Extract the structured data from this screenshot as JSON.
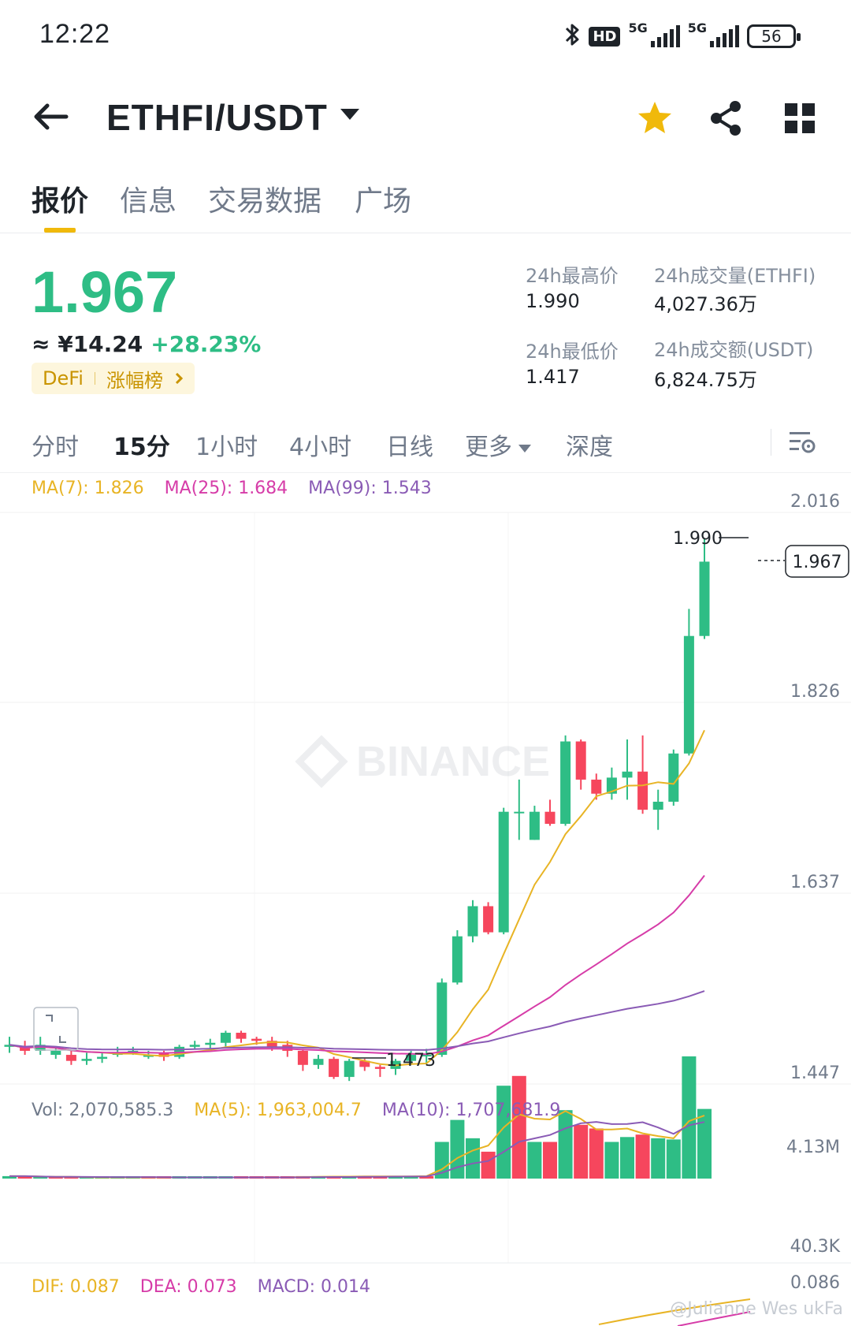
{
  "status_bar": {
    "time": "12:22",
    "hd_label": "HD",
    "sim1_label": "5G",
    "sim2_label": "5G",
    "battery": "56",
    "icons": [
      "bluetooth-icon",
      "hd-voice-icon",
      "signal-icon",
      "signal-icon",
      "battery-icon"
    ]
  },
  "header": {
    "pair": "ETHFI/USDT",
    "icons": [
      "back-arrow-icon",
      "star-icon",
      "share-icon",
      "grid-icon"
    ],
    "star_color": "#f0b90b"
  },
  "tabs": [
    {
      "label": "报价",
      "active": true
    },
    {
      "label": "信息",
      "active": false
    },
    {
      "label": "交易数据",
      "active": false
    },
    {
      "label": "广场",
      "active": false
    }
  ],
  "price": {
    "last": "1.967",
    "cny": "≈ ¥14.24",
    "change_pct": "+28.23%",
    "tag_sector": "DeFi",
    "tag_rank": "涨幅榜",
    "up_color": "#2ebd85",
    "down_color": "#f6465d"
  },
  "stats": {
    "high_label": "24h最高价",
    "high_value": "1.990",
    "low_label": "24h最低价",
    "low_value": "1.417",
    "vol_base_label": "24h成交量(ETHFI)",
    "vol_base_value": "4,027.36万",
    "vol_quote_label": "24h成交额(USDT)",
    "vol_quote_value": "6,824.75万"
  },
  "intervals": [
    {
      "label": "分时",
      "active": false
    },
    {
      "label": "15分",
      "active": true
    },
    {
      "label": "1小时",
      "active": false
    },
    {
      "label": "4小时",
      "active": false
    },
    {
      "label": "日线",
      "active": false
    },
    {
      "label": "更多",
      "active": false
    },
    {
      "label": "深度",
      "active": false
    }
  ],
  "ma_legend": {
    "ma7": "MA(7): 1.826",
    "ma25": "MA(25): 1.684",
    "ma99": "MA(99): 1.543",
    "ma7_color": "#e8b425",
    "ma25_color": "#d63ca8",
    "ma99_color": "#8a5bb5"
  },
  "vol_legend": {
    "vol": "Vol: 2,070,585.3",
    "ma5": "MA(5): 1,963,004.7",
    "ma10": "MA(10): 1,707,681.9"
  },
  "macd_legend": {
    "dif": "DIF: 0.087",
    "dea": "DEA: 0.073",
    "macd": "MACD: 0.014"
  },
  "watermark": "BINANCE",
  "credit": "@Julianne Wes ukFa",
  "chart_data": {
    "type": "candlestick",
    "price_axis": [
      "2.016",
      "1.826",
      "1.637",
      "1.447"
    ],
    "volume_axis": [
      "4.13M",
      "40.3K"
    ],
    "macd_axis": [
      "0.086"
    ],
    "high_marker": "1.990",
    "low_marker": "1.473",
    "last_price_tag": "1.967",
    "ylim": [
      1.447,
      2.016
    ],
    "candles": [
      [
        1.484,
        1.486,
        1.478,
        1.494
      ],
      [
        1.484,
        1.48,
        1.476,
        1.49
      ],
      [
        1.48,
        1.486,
        1.476,
        1.494
      ],
      [
        1.476,
        1.48,
        1.472,
        1.484
      ],
      [
        1.476,
        1.47,
        1.466,
        1.48
      ],
      [
        1.47,
        1.472,
        1.466,
        1.478
      ],
      [
        1.472,
        1.474,
        1.468,
        1.478
      ],
      [
        1.476,
        1.478,
        1.474,
        1.484
      ],
      [
        1.478,
        1.48,
        1.476,
        1.484
      ],
      [
        1.474,
        1.476,
        1.472,
        1.48
      ],
      [
        1.478,
        1.474,
        1.47,
        1.48
      ],
      [
        1.474,
        1.484,
        1.472,
        1.486
      ],
      [
        1.484,
        1.486,
        1.482,
        1.49
      ],
      [
        1.486,
        1.488,
        1.482,
        1.492
      ],
      [
        1.488,
        1.498,
        1.484,
        1.5
      ],
      [
        1.498,
        1.492,
        1.488,
        1.5
      ],
      [
        1.492,
        1.49,
        1.486,
        1.494
      ],
      [
        1.49,
        1.484,
        1.48,
        1.494
      ],
      [
        1.486,
        1.48,
        1.474,
        1.49
      ],
      [
        1.48,
        1.466,
        1.46,
        1.482
      ],
      [
        1.466,
        1.472,
        1.462,
        1.476
      ],
      [
        1.472,
        1.454,
        1.452,
        1.474
      ],
      [
        1.454,
        1.47,
        1.45,
        1.472
      ],
      [
        1.47,
        1.464,
        1.46,
        1.472
      ],
      [
        1.464,
        1.462,
        1.454,
        1.466
      ],
      [
        1.462,
        1.47,
        1.456,
        1.472
      ],
      [
        1.47,
        1.476,
        1.466,
        1.48
      ],
      [
        1.476,
        1.476,
        1.468,
        1.482
      ],
      [
        1.476,
        1.548,
        1.474,
        1.552
      ],
      [
        1.548,
        1.594,
        1.546,
        1.6
      ],
      [
        1.594,
        1.624,
        1.588,
        1.63
      ],
      [
        1.624,
        1.598,
        1.596,
        1.628
      ],
      [
        1.598,
        1.718,
        1.596,
        1.722
      ],
      [
        1.718,
        1.718,
        1.69,
        1.75
      ],
      [
        1.69,
        1.718,
        1.69,
        1.724
      ],
      [
        1.718,
        1.706,
        1.704,
        1.73
      ],
      [
        1.706,
        1.788,
        1.704,
        1.794
      ],
      [
        1.788,
        1.75,
        1.74,
        1.79
      ],
      [
        1.75,
        1.736,
        1.73,
        1.756
      ],
      [
        1.736,
        1.752,
        1.73,
        1.762
      ],
      [
        1.752,
        1.758,
        1.73,
        1.79
      ],
      [
        1.758,
        1.72,
        1.716,
        1.794
      ],
      [
        1.72,
        1.728,
        1.7,
        1.74
      ],
      [
        1.728,
        1.776,
        1.724,
        1.78
      ],
      [
        1.776,
        1.893,
        1.774,
        1.92
      ],
      [
        1.893,
        1.967,
        1.89,
        1.99
      ]
    ],
    "volumes": [
      0.02,
      0.02,
      0.01,
      0.01,
      0.01,
      0.01,
      0.01,
      0.01,
      0.01,
      0.01,
      0.01,
      0.01,
      0.01,
      0.01,
      0.01,
      0.01,
      0.01,
      0.01,
      0.01,
      0.02,
      0.02,
      0.02,
      0.01,
      0.02,
      0.02,
      0.02,
      0.02,
      0.02,
      0.3,
      0.48,
      0.33,
      0.22,
      0.76,
      0.84,
      0.3,
      0.3,
      0.56,
      0.44,
      0.41,
      0.3,
      0.34,
      0.36,
      0.33,
      0.32,
      1.0,
      0.57
    ],
    "volume_up": [
      true,
      false,
      true,
      false,
      false,
      true,
      true,
      true,
      true,
      false,
      false,
      true,
      true,
      true,
      true,
      false,
      false,
      false,
      false,
      false,
      true,
      false,
      true,
      false,
      false,
      true,
      true,
      false,
      true,
      true,
      true,
      false,
      true,
      false,
      true,
      false,
      true,
      false,
      false,
      true,
      true,
      false,
      true,
      true,
      true,
      true
    ]
  }
}
